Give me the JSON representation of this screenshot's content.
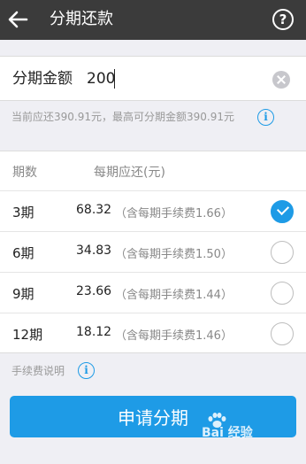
{
  "header": {
    "title": "分期还款",
    "back_icon": "back-arrow-icon",
    "help_icon": "help-icon",
    "help_glyph": "?"
  },
  "amount": {
    "label": "分期金额",
    "value": "200",
    "clear_icon": "clear-icon"
  },
  "hint": {
    "text": "当前应还390.91元，最高可分期金额390.91元",
    "info_glyph": "i"
  },
  "plans": {
    "header_term": "期数",
    "header_payment": "每期应还(元)",
    "rows": [
      {
        "term": "3期",
        "amount": "68.32",
        "fee": "（含每期手续费1.66）",
        "selected": true
      },
      {
        "term": "6期",
        "amount": "34.83",
        "fee": "（含每期手续费1.50）",
        "selected": false
      },
      {
        "term": "9期",
        "amount": "23.66",
        "fee": "（含每期手续费1.44）",
        "selected": false
      },
      {
        "term": "12期",
        "amount": "18.12",
        "fee": "（含每期手续费1.46）",
        "selected": false
      }
    ]
  },
  "fee_note": {
    "text": "手续费说明",
    "info_glyph": "i"
  },
  "apply_button": {
    "label": "申请分期"
  },
  "watermark": {
    "text": "Bai 经验",
    "icon": "baidu-paw-icon"
  },
  "colors": {
    "topbar": "#3b3b3b",
    "accent": "#1e9be6",
    "background": "#efeff4"
  }
}
